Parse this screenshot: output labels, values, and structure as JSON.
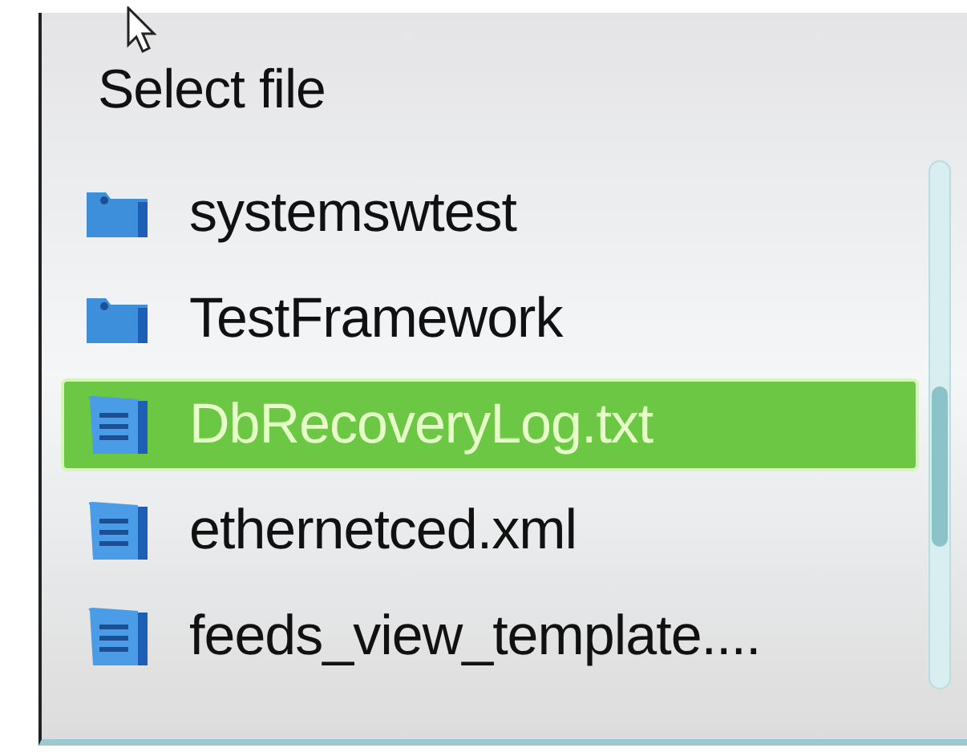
{
  "dialog": {
    "title": "Select file"
  },
  "items": [
    {
      "kind": "folder",
      "name": "systemswtest",
      "selected": false
    },
    {
      "kind": "folder",
      "name": "TestFramework",
      "selected": false
    },
    {
      "kind": "file",
      "name": "DbRecoveryLog.txt",
      "selected": true
    },
    {
      "kind": "file",
      "name": "ethernetced.xml",
      "selected": false
    },
    {
      "kind": "file",
      "name": "feeds_view_template....",
      "selected": false
    }
  ]
}
